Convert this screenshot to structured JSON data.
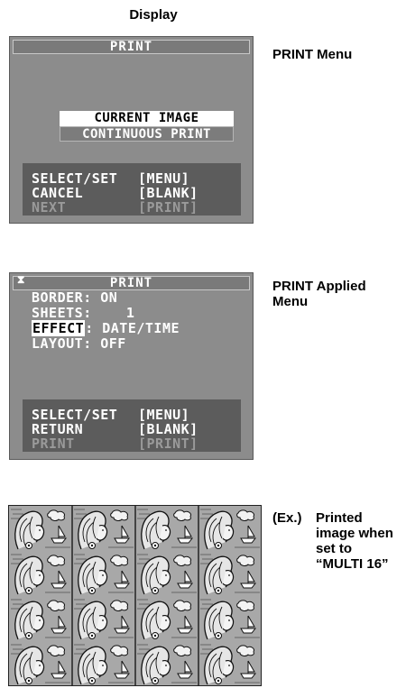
{
  "header": {
    "display_label": "Display"
  },
  "screen1": {
    "title": "PRINT",
    "options": [
      "CURRENT IMAGE",
      "CONTINUOUS PRINT"
    ],
    "footer": [
      {
        "left": "SELECT/SET",
        "right": "[MENU]",
        "dim": false
      },
      {
        "left": "CANCEL",
        "right": "[BLANK]",
        "dim": false
      },
      {
        "left": "NEXT",
        "right": "[PRINT]",
        "dim": true
      }
    ]
  },
  "screen2": {
    "title": "PRINT",
    "settings": [
      {
        "key": "BORDER",
        "value": "ON",
        "highlight": false
      },
      {
        "key": "SHEETS",
        "value": "1",
        "highlight": false
      },
      {
        "key": "EFFECT",
        "value": "DATE/TIME",
        "highlight": true
      },
      {
        "key": "LAYOUT",
        "value": "OFF",
        "highlight": false
      }
    ],
    "footer": [
      {
        "left": "SELECT/SET",
        "right": "[MENU]",
        "dim": false
      },
      {
        "left": "RETURN",
        "right": "[BLANK]",
        "dim": false
      },
      {
        "left": "PRINT",
        "right": "[PRINT]",
        "dim": true
      }
    ]
  },
  "labels": {
    "print_menu": "PRINT Menu",
    "applied_line1": "PRINT Applied",
    "applied_line2": "Menu",
    "ex_prefix": "(Ex.)",
    "ex_lines": [
      "Printed",
      "image when",
      "set to",
      "“MULTI 16”"
    ]
  },
  "colors": {
    "lcd_bg": "#8c8c8c",
    "footer_bg": "#5c5c5c",
    "arrow": "#000000"
  },
  "printed_image": {
    "grid_rows": 4,
    "grid_cols": 4
  }
}
